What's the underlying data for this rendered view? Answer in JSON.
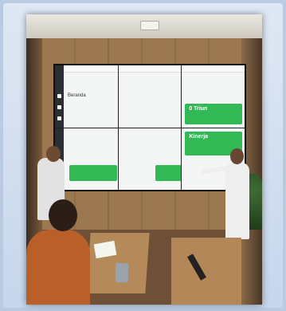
{
  "videowall": {
    "page_heading": "Beranda",
    "card_top_title": "0 Triun",
    "card_bottom_title": "Kinerja"
  },
  "colors": {
    "card_green": "#32b956",
    "sidebar_dark": "#2b2e33"
  }
}
